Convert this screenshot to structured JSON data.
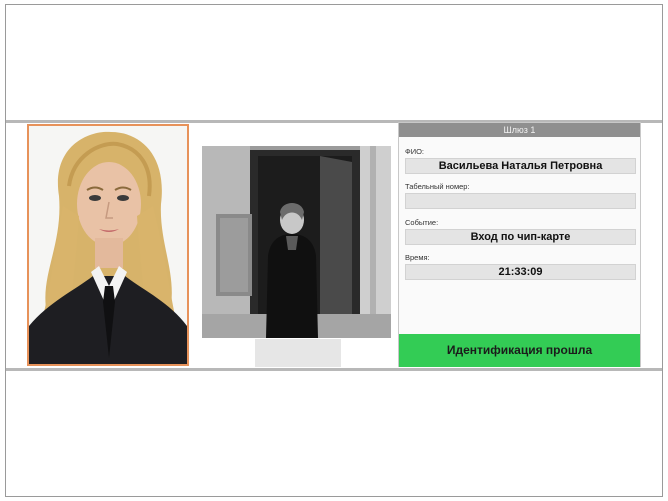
{
  "panel": {
    "title": "Шлюз 1",
    "fio_label": "ФИО:",
    "fio_value": "Васильева Наталья Петровна",
    "tab_label": "Табельный номер:",
    "tab_value": "",
    "event_label": "Событие:",
    "event_value": "Вход по чип-карте",
    "time_label": "Время:",
    "time_value": "21:33:09",
    "status": "Идентификация прошла",
    "status_color": "#33cc55"
  },
  "colors": {
    "photo_border": "#e7925a",
    "band_border": "#b8b8b8",
    "header_bg": "#8f8f8f"
  },
  "icons": [
    "employee-photo",
    "camera-snapshot"
  ]
}
